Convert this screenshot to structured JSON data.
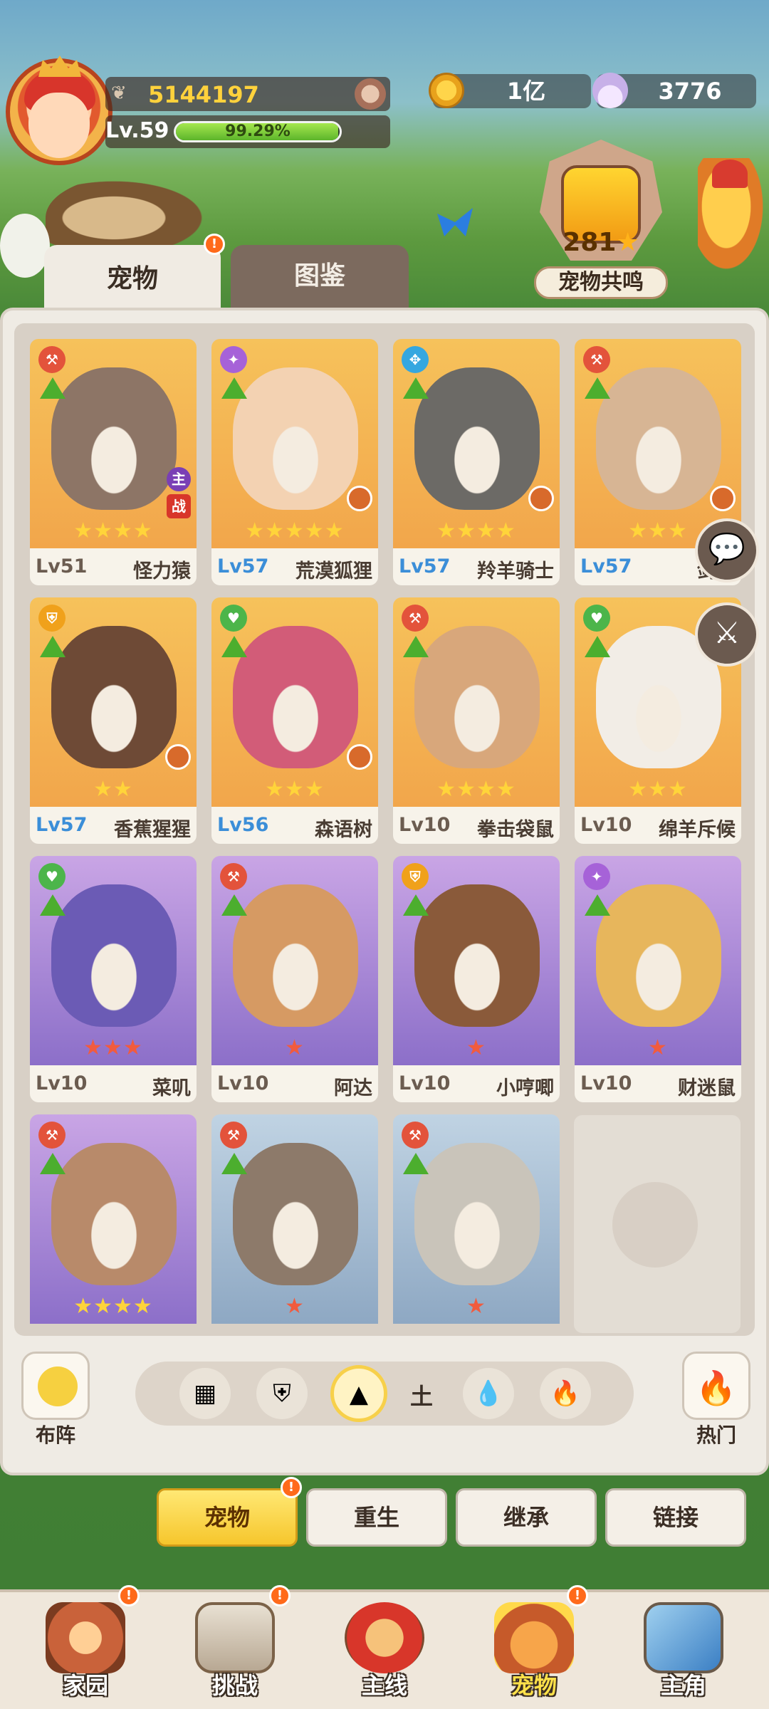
{
  "player": {
    "power": "5144197",
    "level": "Lv.59",
    "exp_percent": "99.29%",
    "exp_fraction": 0.9929
  },
  "currency": {
    "gold": "1亿",
    "shells": "3776"
  },
  "resonance": {
    "count": "281",
    "star": "★",
    "label": "宠物共鸣"
  },
  "tabs": {
    "pets": "宠物",
    "catalog": "图鉴",
    "badge": "!"
  },
  "pets": [
    {
      "level": "Lv51",
      "name": "怪力猿",
      "stars": "★★★★",
      "element": "atk",
      "element_glyph": "⚒",
      "bg": "orange",
      "level_color": "gray",
      "star_color": "gold",
      "badges": [
        "主",
        "战"
      ]
    },
    {
      "level": "Lv57",
      "name": "荒漠狐狸",
      "stars": "★★★★★",
      "element": "mag",
      "element_glyph": "✦",
      "bg": "orange",
      "level_color": "blue",
      "star_color": "gold"
    },
    {
      "level": "Lv57",
      "name": "羚羊骑士",
      "stars": "★★★★",
      "element": "spd",
      "element_glyph": "✥",
      "bg": "orange",
      "level_color": "blue",
      "star_color": "gold"
    },
    {
      "level": "Lv57",
      "name": "剑齿",
      "stars": "★★★",
      "element": "atk",
      "element_glyph": "⚒",
      "bg": "orange",
      "level_color": "blue",
      "star_color": "gold"
    },
    {
      "level": "Lv57",
      "name": "香蕉猩猩",
      "stars": "★★",
      "element": "def",
      "element_glyph": "⛨",
      "bg": "orange",
      "level_color": "blue",
      "star_color": "gold"
    },
    {
      "level": "Lv56",
      "name": "森语树",
      "stars": "★★★",
      "element": "heal",
      "element_glyph": "♥",
      "bg": "orange",
      "level_color": "blue",
      "star_color": "gold"
    },
    {
      "level": "Lv10",
      "name": "拳击袋鼠",
      "stars": "★★★★",
      "element": "atk",
      "element_glyph": "⚒",
      "bg": "orange",
      "level_color": "gray",
      "star_color": "gold"
    },
    {
      "level": "Lv10",
      "name": "绵羊斥候",
      "stars": "★★★",
      "element": "heal",
      "element_glyph": "♥",
      "bg": "orange",
      "level_color": "gray",
      "star_color": "gold"
    },
    {
      "level": "Lv10",
      "name": "菜叽",
      "stars": "★★★",
      "element": "heal",
      "element_glyph": "♥",
      "bg": "purple",
      "level_color": "gray",
      "star_color": "red"
    },
    {
      "level": "Lv10",
      "name": "阿达",
      "stars": "★",
      "element": "atk",
      "element_glyph": "⚒",
      "bg": "purple",
      "level_color": "gray",
      "star_color": "red"
    },
    {
      "level": "Lv10",
      "name": "小哼唧",
      "stars": "★",
      "element": "def",
      "element_glyph": "⛨",
      "bg": "purple",
      "level_color": "gray",
      "star_color": "red"
    },
    {
      "level": "Lv10",
      "name": "财迷鼠",
      "stars": "★",
      "element": "mag",
      "element_glyph": "✦",
      "bg": "purple",
      "level_color": "gray",
      "star_color": "red"
    },
    {
      "level": "",
      "name": "",
      "stars": "★★★★",
      "element": "atk",
      "element_glyph": "⚒",
      "bg": "purple",
      "level_color": "gray",
      "star_color": "gold"
    },
    {
      "level": "",
      "name": "",
      "stars": "★",
      "element": "atk",
      "element_glyph": "⚒",
      "bg": "blue",
      "level_color": "gray",
      "star_color": "red"
    },
    {
      "level": "",
      "name": "",
      "stars": "★",
      "element": "atk",
      "element_glyph": "⚒",
      "bg": "blue",
      "level_color": "gray",
      "star_color": "red"
    }
  ],
  "side_buttons": {
    "chat": "💬",
    "battle": "⚔"
  },
  "filter": {
    "formation_label": "布阵",
    "hot_label": "热门",
    "selected_element_label": "土",
    "buttons": [
      "▦",
      "⛨",
      "▲",
      "💧",
      "🔥"
    ]
  },
  "subtabs": {
    "pets": "宠物",
    "rebirth": "重生",
    "inherit": "继承",
    "link": "链接"
  },
  "nav": {
    "home": "家园",
    "challenge": "挑战",
    "main": "主线",
    "pets": "宠物",
    "hero": "主角"
  },
  "colors": {
    "accent_yellow": "#f6c62c",
    "level_blue": "#3b8ed8",
    "alert_orange": "#ff6a1a"
  }
}
